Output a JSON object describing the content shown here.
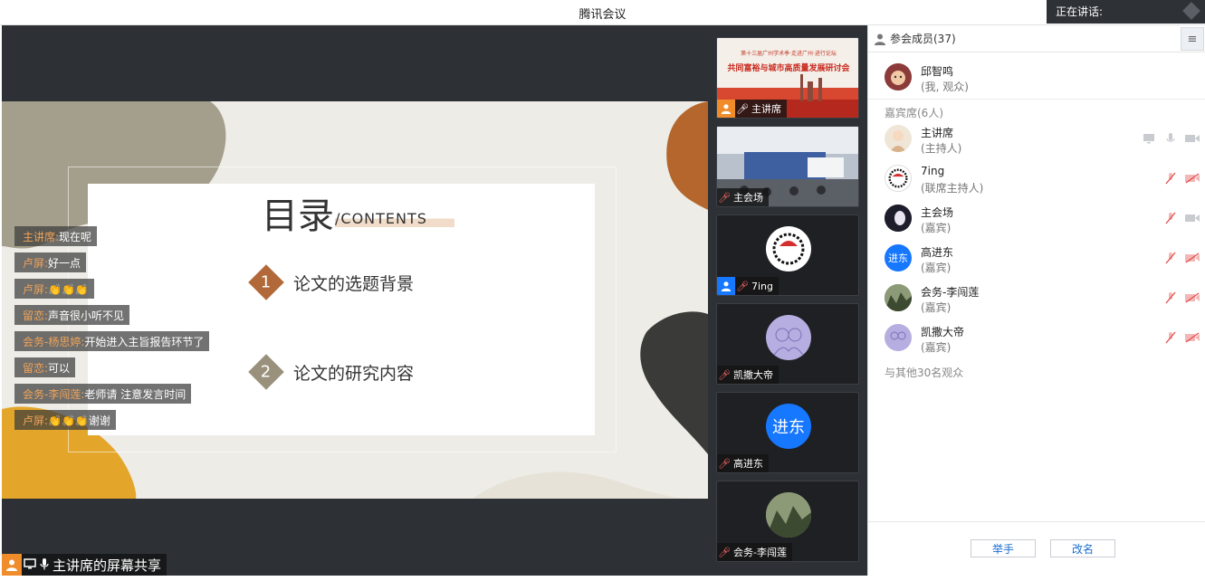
{
  "window": {
    "title": "腾讯会议"
  },
  "speaking": {
    "label": "正在讲话:"
  },
  "slide": {
    "title": "目录",
    "subtitle": "/CONTENTS",
    "items": [
      {
        "num": "1",
        "text": "论文的选题背景"
      },
      {
        "num": "2",
        "text": "论文的研究内容"
      }
    ]
  },
  "chat": [
    {
      "who": "主讲席:",
      "what": "现在呢"
    },
    {
      "who": "卢屏:",
      "what": "好一点"
    },
    {
      "who": "卢屏:",
      "what": "👏👏👏"
    },
    {
      "who": "留恋:",
      "what": "声音很小听不见"
    },
    {
      "who": "会务-杨思婷:",
      "what": "开始进入主旨报告环节了"
    },
    {
      "who": "留恋:",
      "what": "可以"
    },
    {
      "who": "会务-李闯莲:",
      "what": "老师请 注意发言时间"
    },
    {
      "who": "卢屏:",
      "what": "👏👏👏谢谢"
    }
  ],
  "share_label": "主讲席的屏幕共享",
  "tiles": [
    {
      "name": "主讲席",
      "muted": false
    },
    {
      "name": "主会场",
      "muted": true
    },
    {
      "name": "7ing",
      "muted": true
    },
    {
      "name": "凯撒大帝",
      "muted": true
    },
    {
      "name": "高进东",
      "muted": true,
      "avatar_text": "进东"
    },
    {
      "name": "会务-李闯莲",
      "muted": true
    }
  ],
  "tile1_banner": {
    "line1": "第十三届广州学术季·走进广州·进行论坛",
    "line2": "共同富裕与城市高质量发展研讨会"
  },
  "panel": {
    "title": "参会成员(37)",
    "me": {
      "name": "邱智鸣",
      "role": "(我, 观众)"
    },
    "section": "嘉宾席(6人)",
    "members": [
      {
        "name": "主讲席",
        "role": "(主持人)"
      },
      {
        "name": "7ing",
        "role": "(联席主持人)"
      },
      {
        "name": "主会场",
        "role": "(嘉宾)"
      },
      {
        "name": "高进东",
        "role": "(嘉宾)",
        "avatar_text": "进东"
      },
      {
        "name": "会务-李闯莲",
        "role": "(嘉宾)"
      },
      {
        "name": "凯撒大帝",
        "role": "(嘉宾)"
      }
    ],
    "more": "与其他30名观众",
    "buttons": {
      "raise": "举手",
      "rename": "改名"
    }
  },
  "colors": {
    "accent": "#1a6fd1",
    "muted_red": "#e84a4a",
    "chat_name": "#f0a35a",
    "avatar_blue": "#1677ff"
  }
}
